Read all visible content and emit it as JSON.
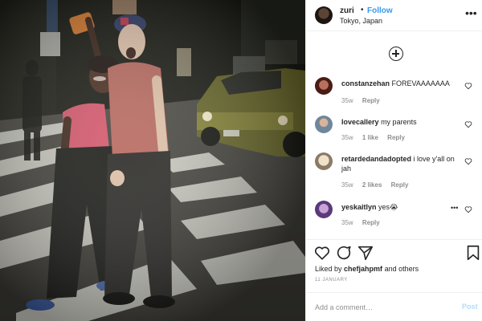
{
  "post": {
    "username": "zuri",
    "separator": "•",
    "follow_label": "Follow",
    "location": "Tokyo, Japan",
    "more_icon": "more-horizontal-icon"
  },
  "comments": [
    {
      "username": "constanzehan",
      "text": "FOREVAAAAAAA",
      "age": "35w",
      "likes": "",
      "reply": "Reply"
    },
    {
      "username": "lovecallery",
      "text": "my parents",
      "age": "35w",
      "likes": "1 like",
      "reply": "Reply"
    },
    {
      "username": "retardedandadopted",
      "text": "i love y'all on jah",
      "age": "35w",
      "likes": "2 likes",
      "reply": "Reply"
    },
    {
      "username": "yeskaitlyn",
      "text": "yes😭",
      "age": "35w",
      "likes": "",
      "reply": "Reply"
    }
  ],
  "actions": {
    "liked_by_prefix": "Liked by",
    "liked_by_user": "chefjahpmf",
    "liked_by_suffix": "and others",
    "date": "11 JANUARY"
  },
  "add_comment": {
    "placeholder": "Add a comment…",
    "post_label": "Post"
  },
  "colors": {
    "link_blue": "#3897f0",
    "post_disabled": "#b3dbff",
    "muted": "#8e8e8e",
    "text": "#262626"
  }
}
